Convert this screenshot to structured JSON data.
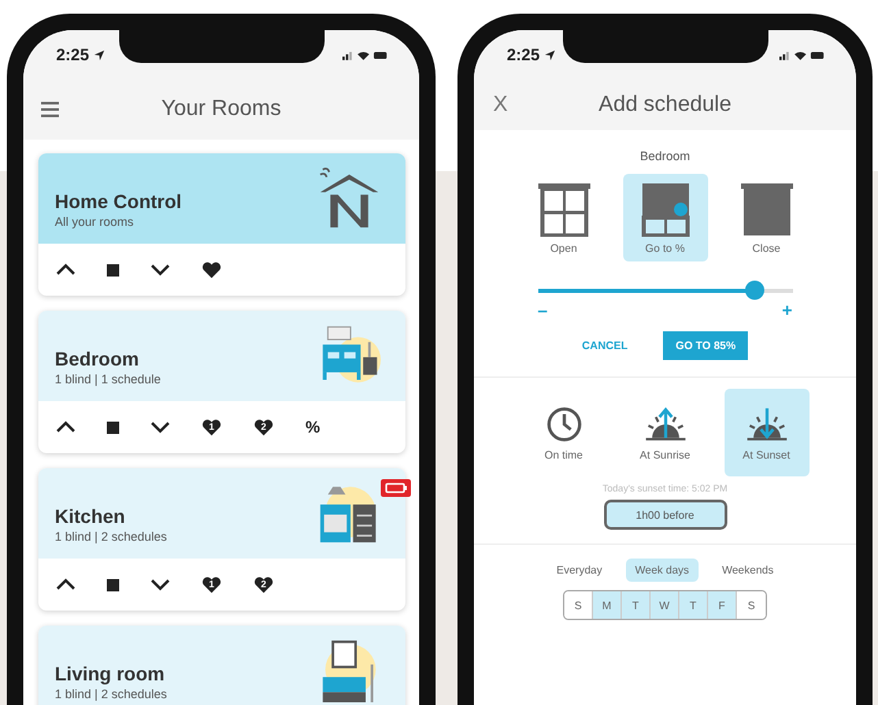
{
  "rooms_screen": {
    "status_time": "2:25",
    "title": "Your Rooms",
    "rooms": [
      {
        "name": "Home Control",
        "subtitle": "All your rooms",
        "featured": true,
        "kind": "house",
        "battery_alert": false,
        "controls": [
          {
            "kind": "up"
          },
          {
            "kind": "stop"
          },
          {
            "kind": "down"
          },
          {
            "kind": "heart"
          }
        ]
      },
      {
        "name": "Bedroom",
        "subtitle": "1 blind | 1 schedule",
        "featured": false,
        "kind": "bedroom",
        "battery_alert": false,
        "controls": [
          {
            "kind": "up"
          },
          {
            "kind": "stop"
          },
          {
            "kind": "down"
          },
          {
            "kind": "heart",
            "label": "1"
          },
          {
            "kind": "heart",
            "label": "2"
          },
          {
            "kind": "text",
            "label": "%"
          }
        ]
      },
      {
        "name": "Kitchen",
        "subtitle": "1 blind | 2 schedules",
        "featured": false,
        "kind": "kitchen",
        "battery_alert": true,
        "controls": [
          {
            "kind": "up"
          },
          {
            "kind": "stop"
          },
          {
            "kind": "down"
          },
          {
            "kind": "heart",
            "label": "1"
          },
          {
            "kind": "heart",
            "label": "2"
          }
        ]
      },
      {
        "name": "Living room",
        "subtitle": "1 blind | 2 schedules",
        "featured": false,
        "kind": "living",
        "battery_alert": false
      }
    ]
  },
  "schedule_screen": {
    "status_time": "2:25",
    "close": "X",
    "title": "Add schedule",
    "room": "Bedroom",
    "actions": [
      {
        "label": "Open",
        "kind": "open",
        "selected": false
      },
      {
        "label": "Go to %",
        "kind": "percent",
        "selected": true
      },
      {
        "label": "Close",
        "kind": "close",
        "selected": false
      }
    ],
    "slider": {
      "level": 0.85,
      "minus": "–",
      "plus": "+"
    },
    "cancel": "CANCEL",
    "confirm": "GO TO 85%",
    "timing": [
      {
        "label": "On time",
        "kind": "clock",
        "selected": false
      },
      {
        "label": "At Sunrise",
        "kind": "sunrise",
        "selected": false
      },
      {
        "label": "At Sunset",
        "kind": "sunset",
        "selected": true
      }
    ],
    "sunset_note": "Today's sunset time: 5:02 PM",
    "offset": "1h00 before",
    "periods": [
      {
        "label": "Everyday",
        "selected": false
      },
      {
        "label": "Week days",
        "selected": true
      },
      {
        "label": "Weekends",
        "selected": false
      }
    ],
    "days": [
      {
        "label": "S",
        "selected": false
      },
      {
        "label": "M",
        "selected": true
      },
      {
        "label": "T",
        "selected": true
      },
      {
        "label": "W",
        "selected": true
      },
      {
        "label": "T",
        "selected": true
      },
      {
        "label": "F",
        "selected": true
      },
      {
        "label": "S",
        "selected": false
      }
    ]
  }
}
